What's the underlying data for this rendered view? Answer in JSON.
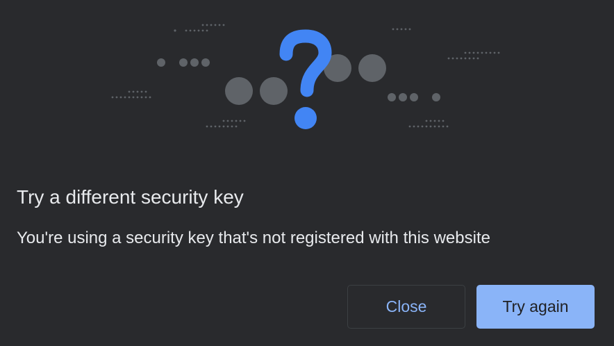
{
  "dialog": {
    "title": "Try a different security key",
    "description": "You're using a security key that's not registered with this website",
    "close_label": "Close",
    "try_again_label": "Try again"
  },
  "illustration": {
    "icon": "question-mark-icon",
    "accent_color": "#4285f4",
    "dot_color": "#5f6368"
  },
  "colors": {
    "background": "#292a2d",
    "text": "#e8eaed",
    "button_accent": "#8ab4f8"
  }
}
